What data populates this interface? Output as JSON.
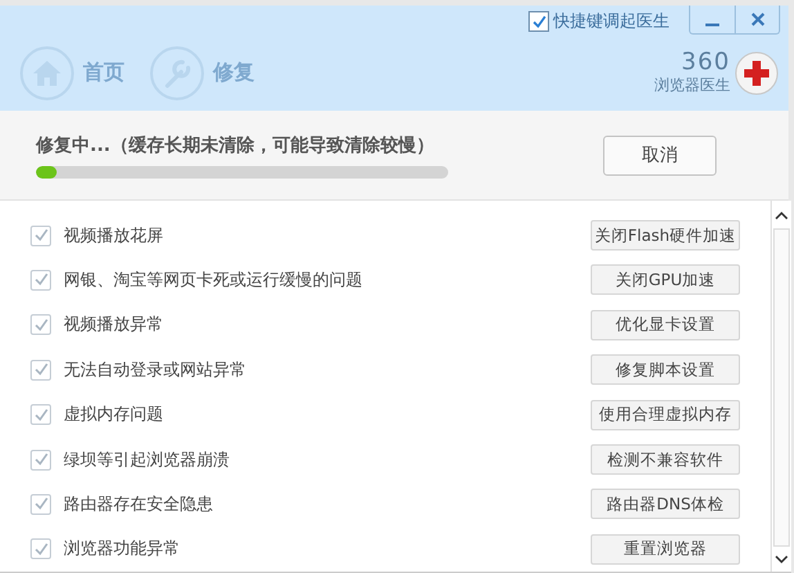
{
  "header": {
    "hotkey": {
      "label": "快捷键调起医生",
      "checked": true
    },
    "nav": [
      {
        "label": "首页"
      },
      {
        "label": "修复"
      }
    ],
    "logo": {
      "number": "360",
      "name": "浏览器医生"
    }
  },
  "progress": {
    "message": "修复中...（缓存长期未清除，可能导致清除较慢）",
    "level": 0.05,
    "cancel": "取消"
  },
  "items": [
    {
      "label": "视频播放花屏",
      "checked": true,
      "action": "关闭Flash硬件加速"
    },
    {
      "label": "网银、淘宝等网页卡死或运行缓慢的问题",
      "checked": true,
      "action": "关闭GPU加速"
    },
    {
      "label": "视频播放异常",
      "checked": true,
      "action": "优化显卡设置"
    },
    {
      "label": "无法自动登录或网站异常",
      "checked": true,
      "action": "修复脚本设置"
    },
    {
      "label": "虚拟内存问题",
      "checked": true,
      "action": "使用合理虚拟内存"
    },
    {
      "label": "绿坝等引起浏览器崩溃",
      "checked": true,
      "action": "检测不兼容软件"
    },
    {
      "label": "路由器存在安全隐患",
      "checked": true,
      "action": "路由器DNS体检"
    },
    {
      "label": "浏览器功能异常",
      "checked": true,
      "action": "重置浏览器"
    }
  ]
}
